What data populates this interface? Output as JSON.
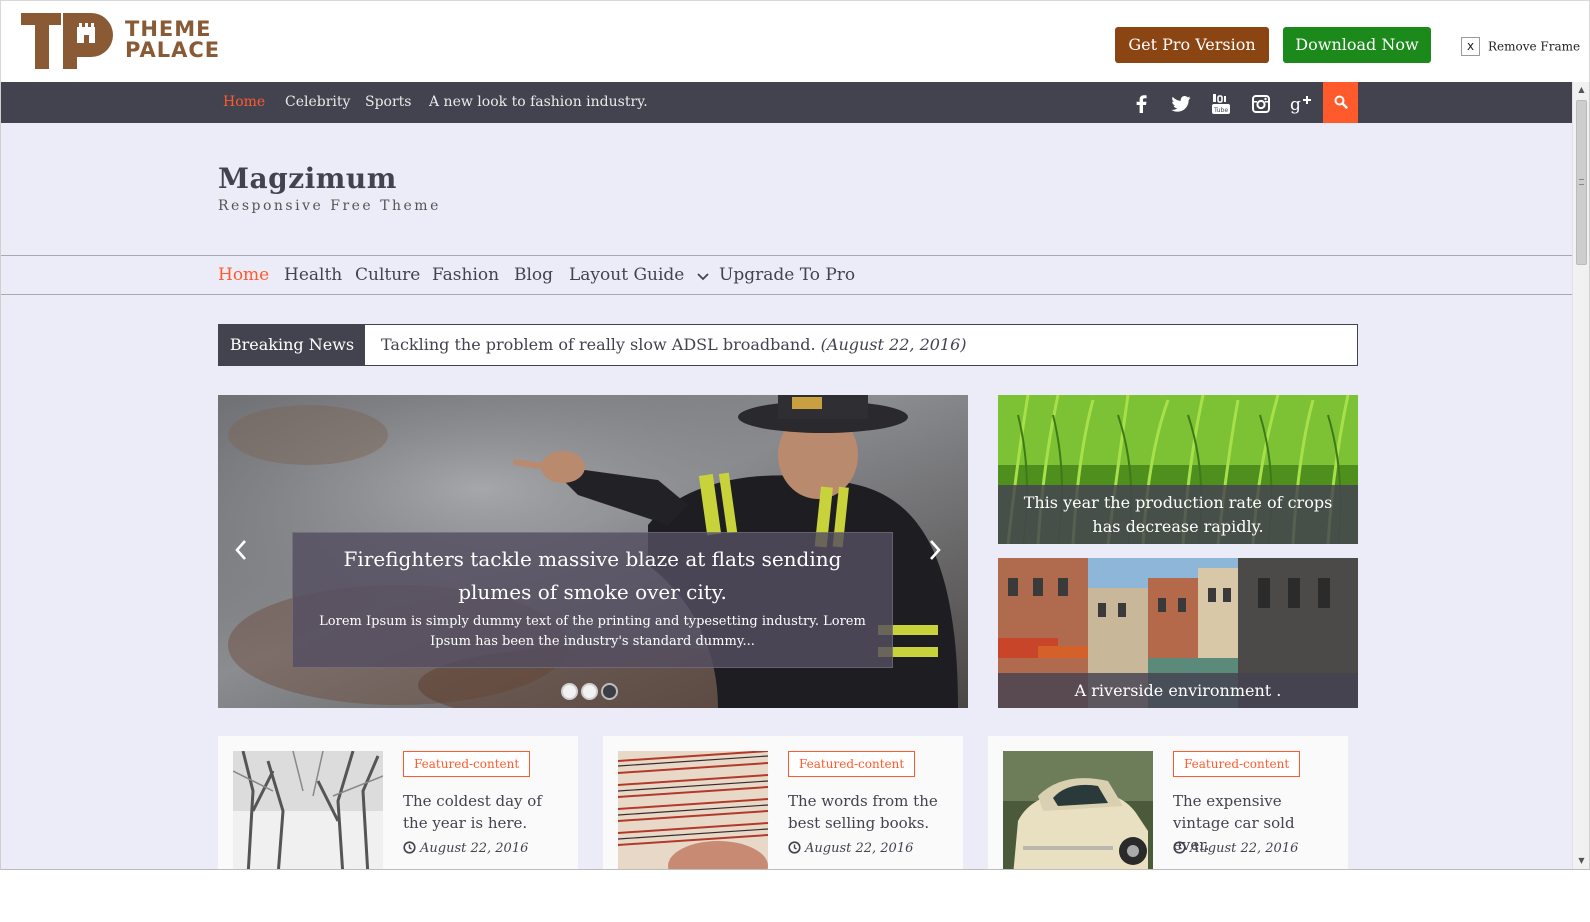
{
  "tp_bar": {
    "logo_line1": "THEME",
    "logo_line2": "PALACE",
    "get_pro_label": "Get Pro Version",
    "download_label": "Download Now",
    "remove_frame_x": "x",
    "remove_frame_label": "Remove Frame",
    "brand_color": "#8a5a35",
    "get_pro_color": "#8b4513",
    "download_color": "#1b8a1b"
  },
  "top_nav": {
    "items": [
      "Home",
      "Celebrity",
      "Sports",
      "A new look to fashion industry."
    ],
    "active": "Home",
    "social": [
      "facebook-icon",
      "twitter-icon",
      "youtube-icon",
      "instagram-icon",
      "google-plus-icon"
    ],
    "search_icon": "search-icon",
    "accent_color": "#ff5a2c",
    "bar_color": "#43434f"
  },
  "header": {
    "title": "Magzimum",
    "tagline": "Responsive Free Theme"
  },
  "main_nav": {
    "items": [
      "Home",
      "Health",
      "Culture",
      "Fashion",
      "Blog",
      "Layout Guide",
      "Upgrade To Pro"
    ],
    "active": "Home"
  },
  "breaking_news": {
    "label": "Breaking News",
    "headline": "Tackling the problem of really slow ADSL broadband.",
    "date": "(August 22, 2016)"
  },
  "slider": {
    "title": "Firefighters tackle massive blaze at flats sending plumes of smoke over city.",
    "excerpt": "Lorem Ipsum is simply dummy text of the printing and typesetting industry. Lorem Ipsum has been the industry's standard dummy...",
    "dots_total": 3
  },
  "side_features": [
    {
      "caption": "This year the production rate of crops has decrease rapidly."
    },
    {
      "caption": "A riverside environment ."
    }
  ],
  "cards": [
    {
      "tag": "Featured-content",
      "title": "The coldest day of the year is here.",
      "date": "August 22, 2016"
    },
    {
      "tag": "Featured-content",
      "title": "The words from the best selling books.",
      "date": "August 22, 2016"
    },
    {
      "tag": "Featured-content",
      "title": "The expensive vintage car sold ever.",
      "date": "August 22, 2016"
    }
  ]
}
